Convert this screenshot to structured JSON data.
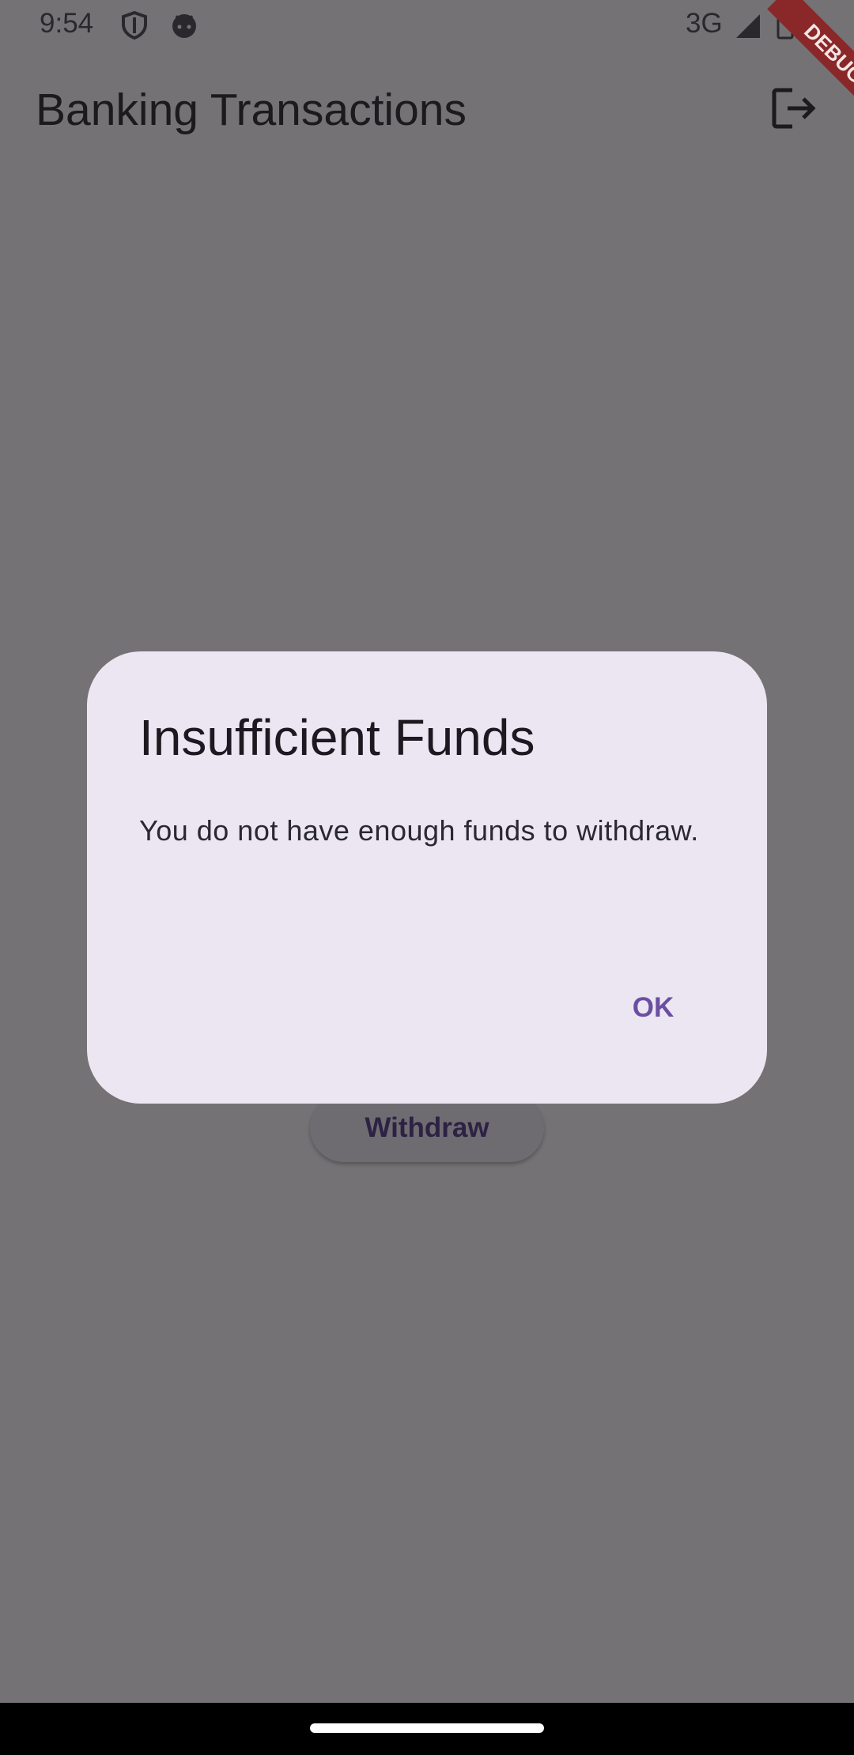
{
  "status_bar": {
    "time": "9:54",
    "network": "3G",
    "icons": [
      "shield-icon",
      "android-face-icon",
      "signal-icon",
      "battery-icon"
    ]
  },
  "app_bar": {
    "title": "Banking Transactions",
    "action_icon": "logout-icon"
  },
  "debug_banner": {
    "label": "DEBUG",
    "color": "#8a2729"
  },
  "main": {
    "withdraw_label": "Withdraw"
  },
  "dialog": {
    "title": "Insufficient Funds",
    "message": "You do not have enough funds to withdraw.",
    "ok_label": "OK",
    "accent": "#6a4ea1"
  },
  "colors": {
    "scrim_background": "#747275",
    "dialog_surface": "#ece6f2"
  }
}
